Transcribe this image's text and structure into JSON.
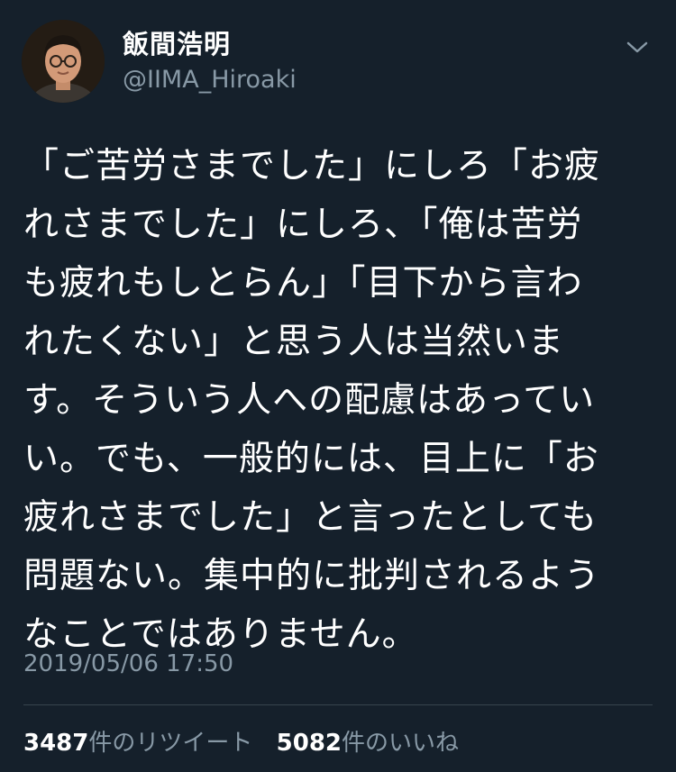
{
  "user": {
    "display_name": "飯間浩明",
    "handle": "@IIMA_Hiroaki"
  },
  "tweet": {
    "text": "「ご苦労さまでした」にしろ「お疲\nれさまでした」にしろ、「俺は苦労\nも疲れもしとらん」「目下から言わ\nれたくない」と思う人は当然いま\nす。そういう人への配慮はあってい\nい。でも、一般的には、目上に「お\n疲れさまでした」と言ったとしても\n問題ない。集中的に批判されるよう\nなことではありません。",
    "timestamp": "2019/05/06 17:50"
  },
  "stats": {
    "retweets_count": "3487",
    "retweets_label": "件のリツイート",
    "likes_count": "5082",
    "likes_label": "件のいいね"
  },
  "icons": {
    "menu": "chevron-down-icon",
    "avatar": "user-avatar"
  },
  "colors": {
    "background": "#15202b",
    "secondary_text": "#8899a6",
    "divider": "#38444d"
  }
}
